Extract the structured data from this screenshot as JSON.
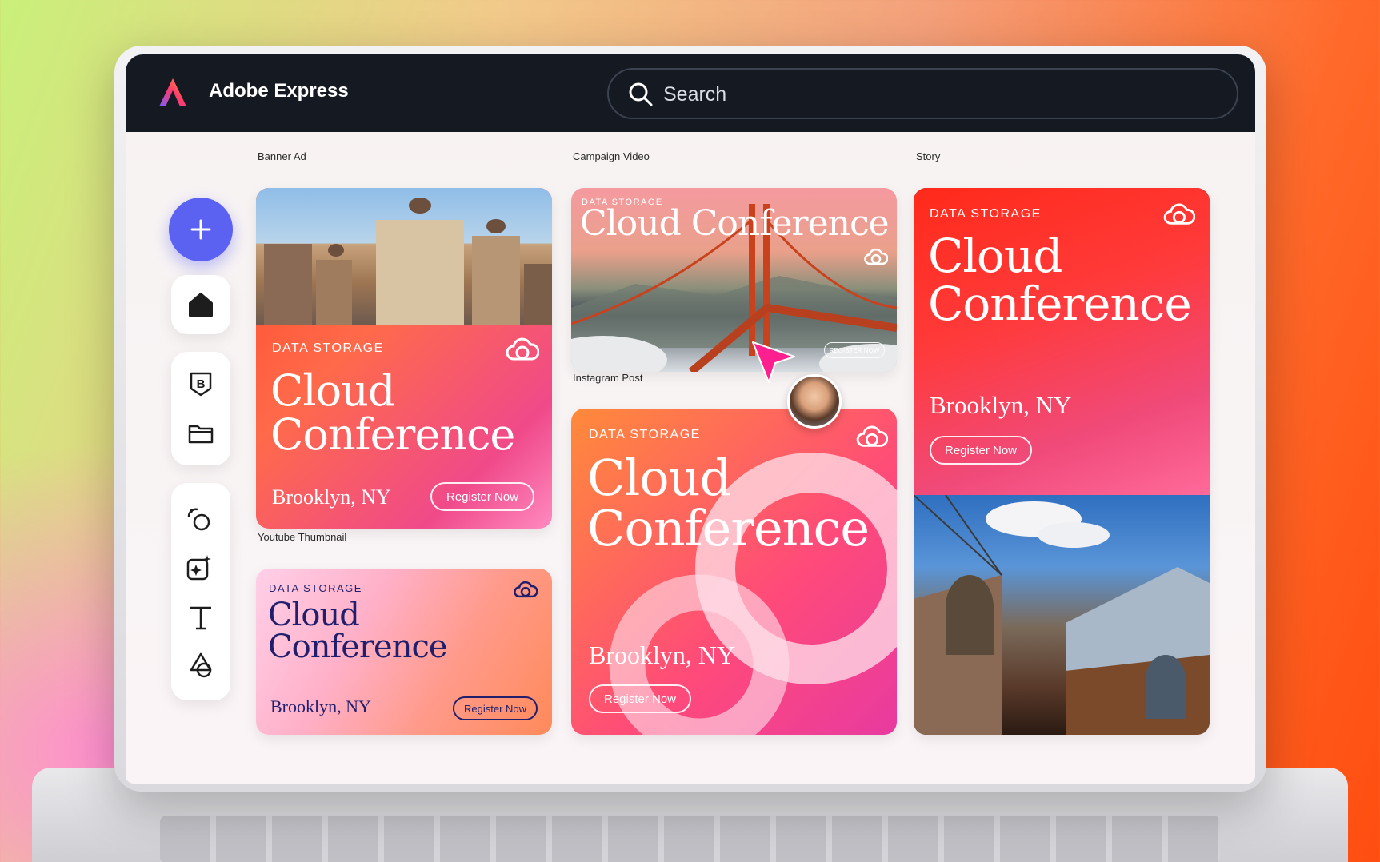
{
  "app": {
    "title": "Adobe Express",
    "search_placeholder": "Search"
  },
  "sidebar": {
    "create_button_label": "+",
    "items": [
      {
        "icon": "home-icon"
      },
      {
        "icon": "brand-icon"
      },
      {
        "icon": "folder-icon"
      },
      {
        "icon": "generate-icon"
      },
      {
        "icon": "magic-edit-icon"
      },
      {
        "icon": "text-icon"
      },
      {
        "icon": "shapes-icon"
      }
    ]
  },
  "sections": {
    "banner_ad": "Banner Ad",
    "campaign_video": "Campaign Video",
    "story": "Story",
    "instagram_post": "Instagram Post",
    "youtube_thumbnail": "Youtube Thumbnail"
  },
  "design": {
    "eyebrow": "DATA STORAGE",
    "headline_line1": "Cloud",
    "headline_line2": "Conference",
    "headline_inline": "Cloud Conference",
    "location": "Brooklyn, NY",
    "cta": "Register Now",
    "cta_upper": "REGISTER NOW"
  },
  "colors": {
    "accent": "#5b61f0",
    "topbar": "#141922",
    "cursor": "#ff1f8e",
    "navy": "#1f1f6e"
  }
}
